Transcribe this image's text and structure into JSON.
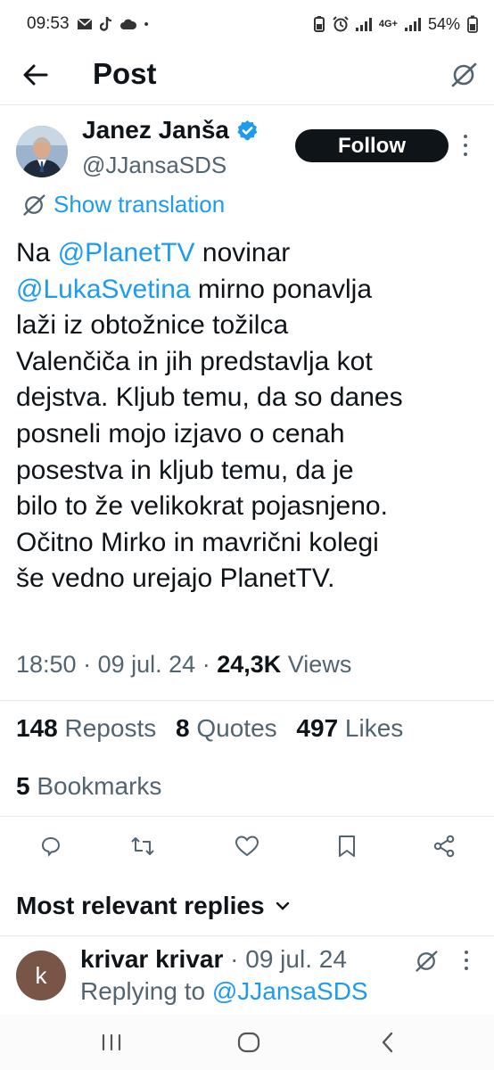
{
  "status_bar": {
    "time": "09:53",
    "network": "4G+",
    "battery": "54%"
  },
  "header": {
    "title": "Post",
    "back_icon": "arrow-left-icon",
    "grok_icon": "grok-icon"
  },
  "post": {
    "author_name": "Janez Janša",
    "author_handle": "@JJansaSDS",
    "follow_label": "Follow",
    "translate_label": "Show translation",
    "text_lines": [
      [
        {
          "t": "Na ",
          "m": false
        },
        {
          "t": "@PlanetTV",
          "m": true
        },
        {
          "t": " novinar",
          "m": false
        }
      ],
      [
        {
          "t": "@LukaSvetina",
          "m": true
        },
        {
          "t": " mirno ponavlja",
          "m": false
        }
      ],
      [
        {
          "t": "laži iz obtožnice tožilca",
          "m": false
        }
      ],
      [
        {
          "t": "Valenčiča in jih predstavlja kot",
          "m": false
        }
      ],
      [
        {
          "t": "dejstva. Kljub temu, da so danes",
          "m": false
        }
      ],
      [
        {
          "t": "posneli mojo izjavo o cenah",
          "m": false
        }
      ],
      [
        {
          "t": "posestva in kljub temu, da je",
          "m": false
        }
      ],
      [
        {
          "t": "bilo to že velikokrat pojasnjeno.",
          "m": false
        }
      ],
      [
        {
          "t": "Očitno Mirko in mavrični kolegi",
          "m": false
        }
      ],
      [
        {
          "t": "še vedno urejajo PlanetTV.",
          "m": false
        }
      ]
    ],
    "time": "18:50",
    "date": "09 jul. 24",
    "views_count": "24,3K",
    "views_label": "Views",
    "reposts_count": "148",
    "reposts_label": "Reposts",
    "quotes_count": "8",
    "quotes_label": "Quotes",
    "likes_count": "497",
    "likes_label": "Likes",
    "bookmarks_count": "5",
    "bookmarks_label": "Bookmarks",
    "accent_color": "#1d9bf0"
  },
  "replies": {
    "header": "Most relevant replies",
    "items": [
      {
        "avatar_letter": "k",
        "name": "krivar krivar",
        "date": "09 jul. 24",
        "replying_prefix": "Replying to",
        "replying_to": "@JJansaSDS"
      }
    ]
  }
}
